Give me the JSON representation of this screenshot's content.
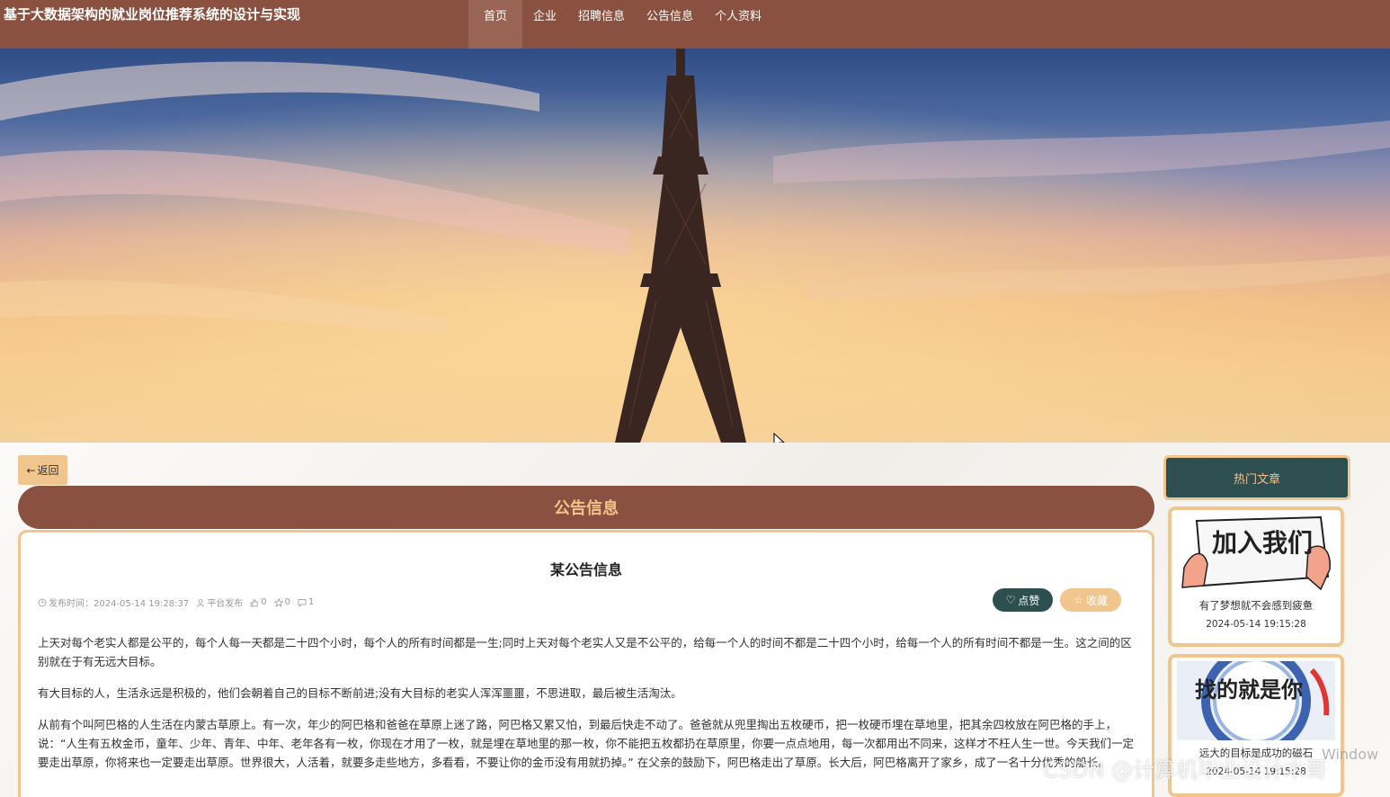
{
  "header": {
    "site_title": "基于大数据架构的就业岗位推荐系统的设计与实现",
    "nav": [
      "首页",
      "企业",
      "招聘信息",
      "公告信息",
      "个人资料"
    ]
  },
  "back_label": "返回",
  "section_title": "公告信息",
  "article": {
    "title": "某公告信息",
    "publish_label": "发布时间：2024-05-14 19:28:37",
    "author": "平台发布",
    "likes": "0",
    "favorites": "0",
    "comments": "1",
    "like_button": "点赞",
    "fav_button": "收藏",
    "paragraphs": [
      "上天对每个老实人都是公平的，每个人每一天都是二十四个小时，每个人的所有时间都是一生;同时上天对每个老实人又是不公平的，给每一个人的时间不都是二十四个小时，给每一个人的所有时间不都是一生。这之间的区别就在于有无远大目标。",
      "有大目标的人，生活永远是积极的，他们会朝着自己的目标不断前进;没有大目标的老实人浑浑噩噩，不思进取，最后被生活淘汰。",
      "从前有个叫阿巴格的人生活在内蒙古草原上。有一次，年少的阿巴格和爸爸在草原上迷了路，阿巴格又累又怕，到最后快走不动了。爸爸就从兜里掏出五枚硬币，把一枚硬币埋在草地里，把其余四枚放在阿巴格的手上，说：“人生有五枚金币，童年、少年、青年、中年、老年各有一枚，你现在才用了一枚，就是埋在草地里的那一枚，你不能把五枚都扔在草原里，你要一点点地用，每一次都用出不同来，这样才不枉人生一世。今天我们一定要走出草原，你将来也一定要走出草原。世界很大，人活着，就要多走些地方，多看看，不要让你的金币没有用就扔掉。” 在父亲的鼓励下，阿巴格走出了草原。长大后，阿巴格离开了家乡，成了一名十分优秀的船长。"
    ]
  },
  "sidebar": {
    "title": "热门文章",
    "items": [
      {
        "title": "有了梦想就不会感到疲惫",
        "date": "2024-05-14 19:15:28",
        "image_text": "加入我们"
      },
      {
        "title": "远大的目标是成功的磁石",
        "date": "2024-05-14 19:15:28",
        "image_text": "找的就是你"
      }
    ]
  },
  "watermark": "CSDN @计算机毕业设计木哥",
  "os_mark": "Window"
}
